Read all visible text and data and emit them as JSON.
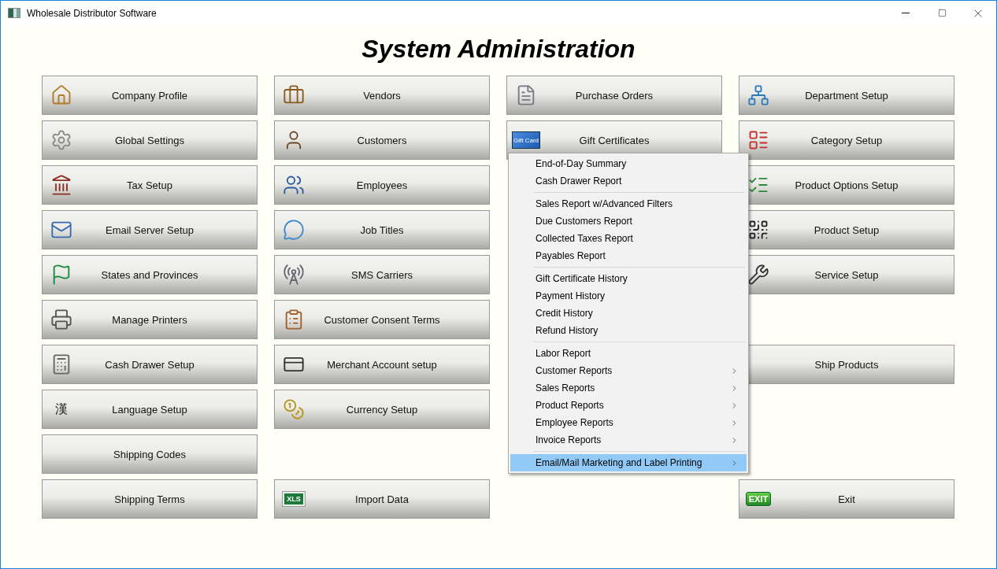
{
  "window": {
    "title": "Wholesale Distributor Software"
  },
  "heading": "System Administration",
  "columns": [
    {
      "buttons": [
        {
          "kind": "button",
          "label": "Company Profile"
        },
        {
          "kind": "button",
          "label": "Global Settings"
        },
        {
          "kind": "button",
          "label": "Tax Setup"
        },
        {
          "kind": "button",
          "label": "Email Server Setup"
        },
        {
          "kind": "button",
          "label": "States and Provinces"
        },
        {
          "kind": "button",
          "label": "Manage Printers"
        },
        {
          "kind": "button",
          "label": "Cash Drawer Setup"
        },
        {
          "kind": "button",
          "label": "Language Setup",
          "icon_text": "漢"
        },
        {
          "kind": "button",
          "label": "Shipping Codes"
        },
        {
          "kind": "button",
          "label": "Shipping Terms"
        }
      ]
    },
    {
      "buttons": [
        {
          "kind": "button",
          "label": "Vendors"
        },
        {
          "kind": "button",
          "label": "Customers"
        },
        {
          "kind": "button",
          "label": "Employees"
        },
        {
          "kind": "button",
          "label": "Job Titles"
        },
        {
          "kind": "button",
          "label": "SMS Carriers"
        },
        {
          "kind": "button",
          "label": "Customer Consent Terms"
        },
        {
          "kind": "button",
          "label": "Merchant Account setup"
        },
        {
          "kind": "button",
          "label": "Currency Setup"
        },
        {
          "kind": "blank"
        },
        {
          "kind": "button",
          "label": "Import Data",
          "icon_text": "XLS"
        }
      ]
    },
    {
      "buttons": [
        {
          "kind": "button",
          "label": "Purchase Orders"
        },
        {
          "kind": "button",
          "label": "Gift Certificates",
          "icon_text": "Gift Card"
        }
      ]
    },
    {
      "buttons": [
        {
          "kind": "button",
          "label": "Department Setup"
        },
        {
          "kind": "button",
          "label": "Category Setup"
        },
        {
          "kind": "button",
          "label": "Product Options Setup"
        },
        {
          "kind": "button",
          "label": "Product Setup"
        },
        {
          "kind": "button",
          "label": "Service Setup"
        },
        {
          "kind": "blank"
        },
        {
          "kind": "button",
          "label": "Ship Products"
        },
        {
          "kind": "blank"
        },
        {
          "kind": "blank"
        },
        {
          "kind": "button",
          "label": "Exit",
          "icon_text": "EXIT"
        }
      ]
    }
  ],
  "menu": {
    "groups": [
      {
        "items": [
          {
            "label": "End-of-Day Summary",
            "submenu": false,
            "selected": false
          },
          {
            "label": "Cash Drawer Report",
            "submenu": false,
            "selected": false
          }
        ]
      },
      {
        "items": [
          {
            "label": "Sales Report w/Advanced Filters",
            "submenu": false,
            "selected": false
          },
          {
            "label": "Due Customers Report",
            "submenu": false,
            "selected": false
          },
          {
            "label": "Collected Taxes Report",
            "submenu": false,
            "selected": false
          },
          {
            "label": "Payables Report",
            "submenu": false,
            "selected": false
          }
        ]
      },
      {
        "items": [
          {
            "label": "Gift Certificate History",
            "submenu": false,
            "selected": false
          },
          {
            "label": "Payment History",
            "submenu": false,
            "selected": false
          },
          {
            "label": "Credit History",
            "submenu": false,
            "selected": false
          },
          {
            "label": "Refund History",
            "submenu": false,
            "selected": false
          }
        ]
      },
      {
        "items": [
          {
            "label": "Labor Report",
            "submenu": false,
            "selected": false
          },
          {
            "label": "Customer Reports",
            "submenu": true,
            "selected": false
          },
          {
            "label": "Sales Reports",
            "submenu": true,
            "selected": false
          },
          {
            "label": "Product Reports",
            "submenu": true,
            "selected": false
          },
          {
            "label": "Employee Reports",
            "submenu": true,
            "selected": false
          },
          {
            "label": "Invoice Reports",
            "submenu": true,
            "selected": false
          }
        ]
      },
      {
        "items": [
          {
            "label": "Email/Mail Marketing and Label Printing",
            "submenu": true,
            "selected": true
          }
        ]
      }
    ]
  }
}
